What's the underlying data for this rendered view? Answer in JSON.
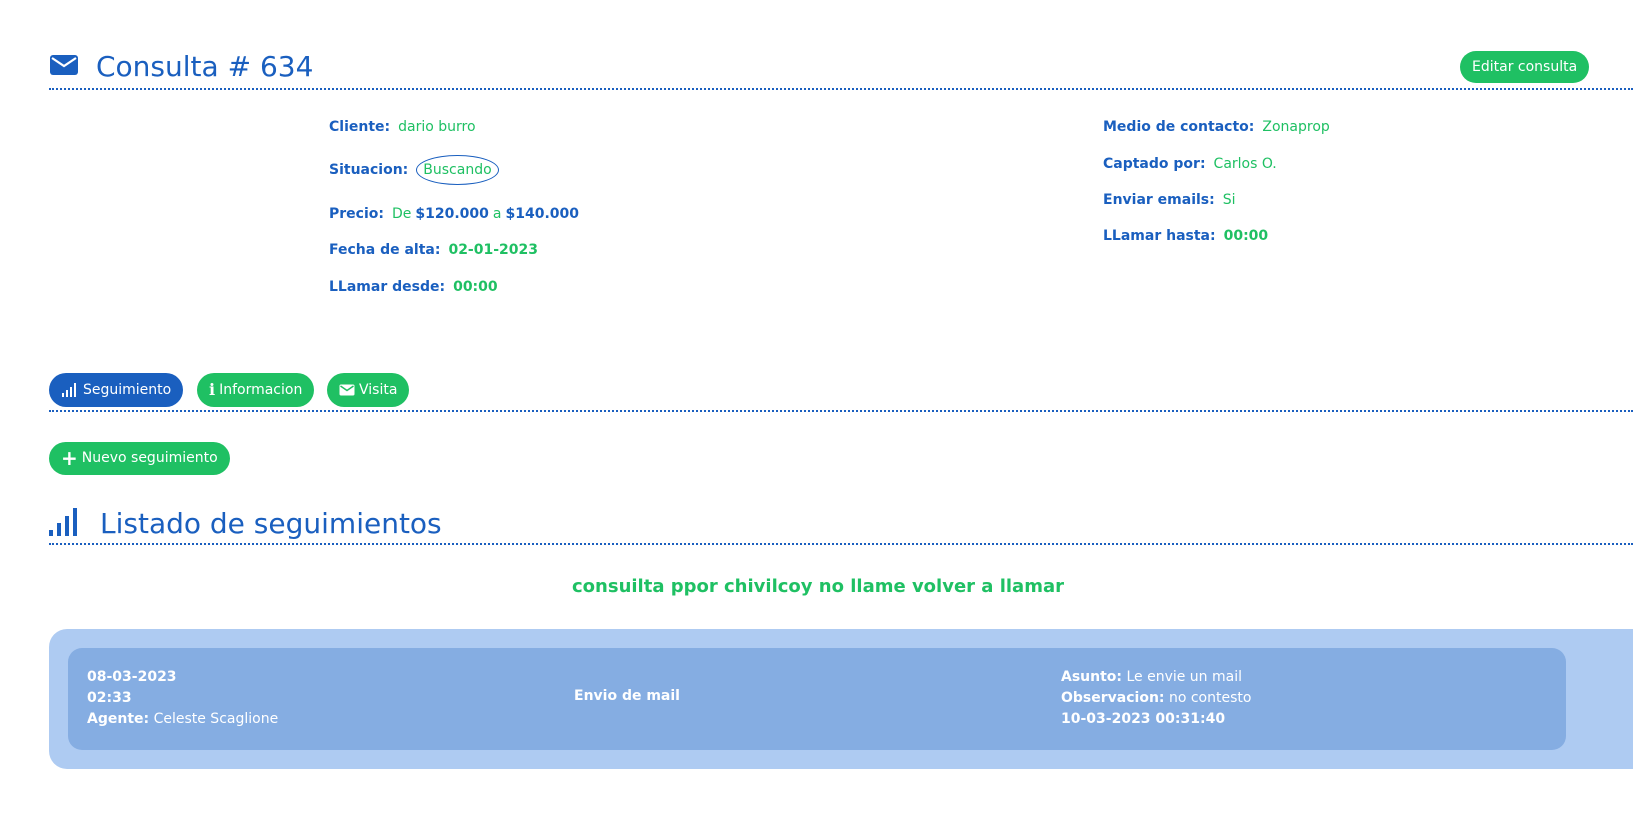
{
  "header": {
    "title": "Consulta # 634",
    "edit_label": "Editar consulta"
  },
  "info": {
    "cliente": {
      "label": "Cliente:",
      "value": "dario burro"
    },
    "situacion": {
      "label": "Situacion:",
      "value": "Buscando"
    },
    "precio": {
      "label": "Precio:",
      "de": "De",
      "from": "$120.000",
      "a": "a",
      "to": "$140.000"
    },
    "fecha_alta": {
      "label": "Fecha de alta:",
      "value": "02-01-2023"
    },
    "llamar_desde": {
      "label": "LLamar desde:",
      "value": "00:00"
    },
    "medio_contacto": {
      "label": "Medio de contacto:",
      "value": "Zonaprop"
    },
    "captado_por": {
      "label": "Captado por:",
      "value": "Carlos O."
    },
    "enviar_emails": {
      "label": "Enviar emails:",
      "value": "Si"
    },
    "llamar_hasta": {
      "label": "LLamar hasta:",
      "value": "00:00"
    }
  },
  "tabs": [
    {
      "label": "Seguimiento",
      "icon": "signal-bars-icon",
      "color": "#1a5fbf",
      "active": true
    },
    {
      "label": "Informacion",
      "icon": "info-icon",
      "color": "#1fc063",
      "active": false
    },
    {
      "label": "Visita",
      "icon": "envelope-icon",
      "color": "#1fc063",
      "active": false
    }
  ],
  "new_button": {
    "label": "Nuevo seguimiento"
  },
  "list": {
    "title": "Listado de seguimientos",
    "note": "consuilta ppor chivilcoy no llame volver a llamar",
    "items": [
      {
        "date": "08-03-2023",
        "time": "02:33",
        "agent_label": "Agente:",
        "agent": "Celeste Scaglione",
        "type": "Envio de mail",
        "asunto_label": "Asunto:",
        "asunto": "Le envie un mail",
        "observacion_label": "Observacion:",
        "observacion": "no contesto",
        "timestamp": "10-03-2023 00:31:40"
      }
    ]
  },
  "colors": {
    "primary": "#1a5fbf",
    "accent": "#1fc063",
    "card_outer": "#aecbf2",
    "card_inner": "#85ade2"
  }
}
